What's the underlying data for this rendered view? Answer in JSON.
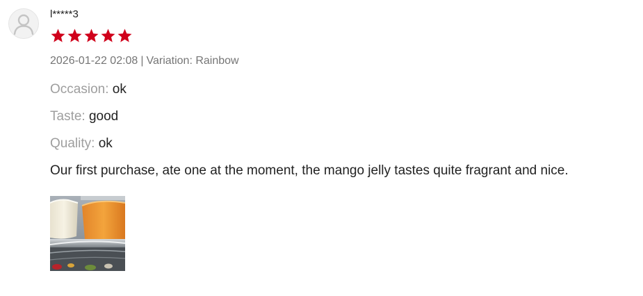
{
  "review": {
    "username": "l*****3",
    "rating": 5,
    "max_rating": 5,
    "star_color": "#d0011b",
    "date": "2026-01-22 02:08",
    "separator": "|",
    "variation_label": "Variation:",
    "variation_value": "Rainbow",
    "attributes": [
      {
        "label": "Occasion:",
        "value": "ok"
      },
      {
        "label": "Taste:",
        "value": "good"
      },
      {
        "label": "Quality:",
        "value": "ok"
      }
    ],
    "comment": "Our first purchase, ate one at the moment, the mango jelly tastes quite fragrant and nice.",
    "avatar_icon": "user-silhouette-icon",
    "photo_icon": "review-photo-jelly-cups"
  }
}
